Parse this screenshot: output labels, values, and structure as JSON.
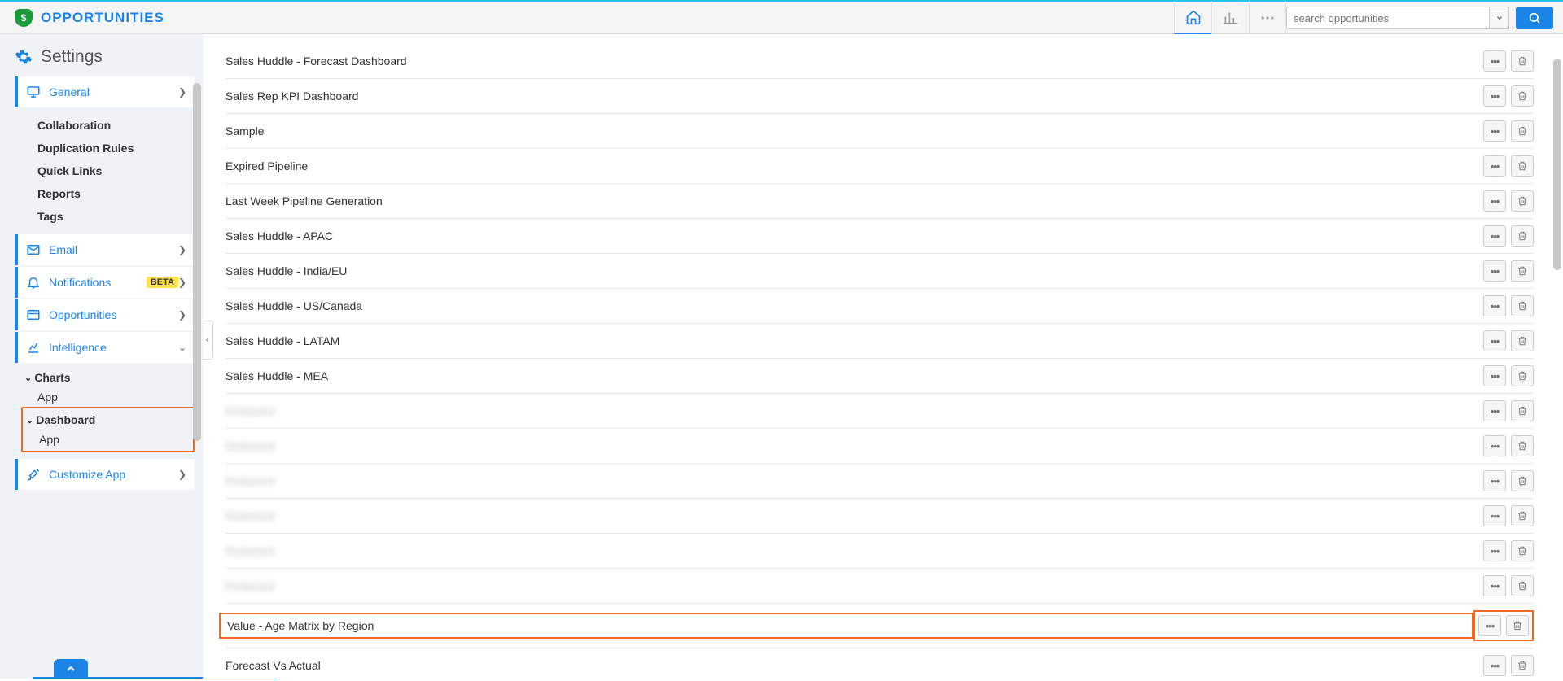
{
  "app": {
    "title": "OPPORTUNITIES"
  },
  "search": {
    "placeholder": "search opportunities"
  },
  "settings_title": "Settings",
  "nav": {
    "general": {
      "label": "General",
      "sub": [
        "Collaboration",
        "Duplication Rules",
        "Quick Links",
        "Reports",
        "Tags"
      ]
    },
    "email": {
      "label": "Email"
    },
    "notifications": {
      "label": "Notifications",
      "badge": "BETA"
    },
    "opportunities": {
      "label": "Opportunities"
    },
    "intelligence": {
      "label": "Intelligence",
      "charts": {
        "label": "Charts",
        "children": [
          "App"
        ]
      },
      "dashboard": {
        "label": "Dashboard",
        "children": [
          "App"
        ]
      }
    },
    "customize": {
      "label": "Customize App"
    }
  },
  "rows": [
    {
      "label": "Sales Huddle - Forecast Dashboard",
      "highlighted": false
    },
    {
      "label": "Sales Rep KPI Dashboard",
      "highlighted": false
    },
    {
      "label": "Sample",
      "highlighted": false
    },
    {
      "label": "Expired Pipeline",
      "highlighted": false
    },
    {
      "label": "Last Week Pipeline Generation",
      "highlighted": false
    },
    {
      "label": "Sales Huddle - APAC",
      "highlighted": false
    },
    {
      "label": "Sales Huddle - India/EU",
      "highlighted": false
    },
    {
      "label": "Sales Huddle - US/Canada",
      "highlighted": false
    },
    {
      "label": "Sales Huddle - LATAM",
      "highlighted": false
    },
    {
      "label": "Sales Huddle - MEA",
      "highlighted": false
    },
    {
      "label": "Redacted",
      "blurred": true
    },
    {
      "label": "Redacted",
      "blurred": true
    },
    {
      "label": "Redacted",
      "blurred": true
    },
    {
      "label": "Redacted",
      "blurred": true
    },
    {
      "label": "Redacted",
      "blurred": true
    },
    {
      "label": "Redacted",
      "blurred": true
    },
    {
      "label": "Value - Age Matrix by Region",
      "highlighted": true
    },
    {
      "label": "Forecast Vs Actual",
      "highlighted": false
    }
  ]
}
